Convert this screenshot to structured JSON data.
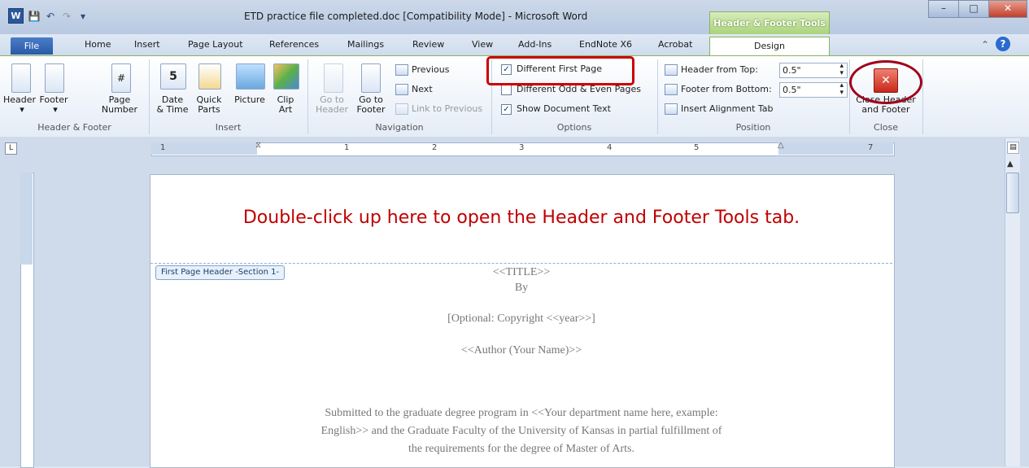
{
  "window": {
    "title": "ETD practice file completed.doc [Compatibility Mode]  -  Microsoft Word",
    "logo": "W",
    "contextual_tab": "Header & Footer Tools",
    "controls": {
      "minimize": "–",
      "maximize": "□",
      "close": "✕"
    }
  },
  "quick_access": {
    "save": "💾",
    "undo": "↶",
    "redo": "↷",
    "customize": "▾"
  },
  "tabs": {
    "file": "File",
    "home": "Home",
    "insert": "Insert",
    "page_layout": "Page Layout",
    "references": "References",
    "mailings": "Mailings",
    "review": "Review",
    "view": "View",
    "addins": "Add-Ins",
    "endnote": "EndNote X6",
    "acrobat": "Acrobat",
    "design": "Design"
  },
  "ribbon": {
    "header_footer": {
      "label": "Header & Footer",
      "header": "Header",
      "footer": "Footer",
      "page_number_1": "Page",
      "page_number_2": "Number"
    },
    "insert": {
      "label": "Insert",
      "date_1": "Date",
      "date_2": "& Time",
      "quick_1": "Quick",
      "quick_2": "Parts",
      "picture": "Picture",
      "clip_1": "Clip",
      "clip_2": "Art"
    },
    "navigation": {
      "label": "Navigation",
      "goto_header_1": "Go to",
      "goto_header_2": "Header",
      "goto_footer_1": "Go to",
      "goto_footer_2": "Footer",
      "previous": "Previous",
      "next": "Next",
      "link_previous": "Link to Previous"
    },
    "options": {
      "label": "Options",
      "different_first": "Different First Page",
      "different_odd_even": "Different Odd & Even Pages",
      "show_doc_text": "Show Document Text",
      "different_first_checked": true,
      "different_odd_even_checked": false,
      "show_doc_text_checked": true
    },
    "position": {
      "label": "Position",
      "header_from_top": "Header from Top:",
      "header_value": "0.5\"",
      "footer_from_bottom": "Footer from Bottom:",
      "footer_value": "0.5\"",
      "alignment_tab": "Insert Alignment Tab"
    },
    "close": {
      "label": "Close",
      "close_1": "Close Header",
      "close_2": "and Footer"
    }
  },
  "ruler": {
    "marks": [
      "1",
      "1",
      "2",
      "3",
      "4",
      "5",
      "7"
    ]
  },
  "document": {
    "annotation": "Double-click up here to open the Header and Footer Tools tab.",
    "header_tag": "First Page Header -Section 1-",
    "title": "<<TITLE>>",
    "by": "By",
    "copyright": "[Optional: Copyright <<year>>]",
    "author": "<<Author (Your Name)>>",
    "submitted_1": "Submitted to the graduate degree program in <<Your department name here, example:",
    "submitted_2": "English>> and the Graduate Faculty of the University of Kansas in partial fulfillment of",
    "submitted_3": "the requirements for the degree of Master of Arts."
  },
  "colors": {
    "accent_red": "#c00000",
    "contextual_green": "#8ab35a",
    "file_blue": "#2a5aa8"
  }
}
